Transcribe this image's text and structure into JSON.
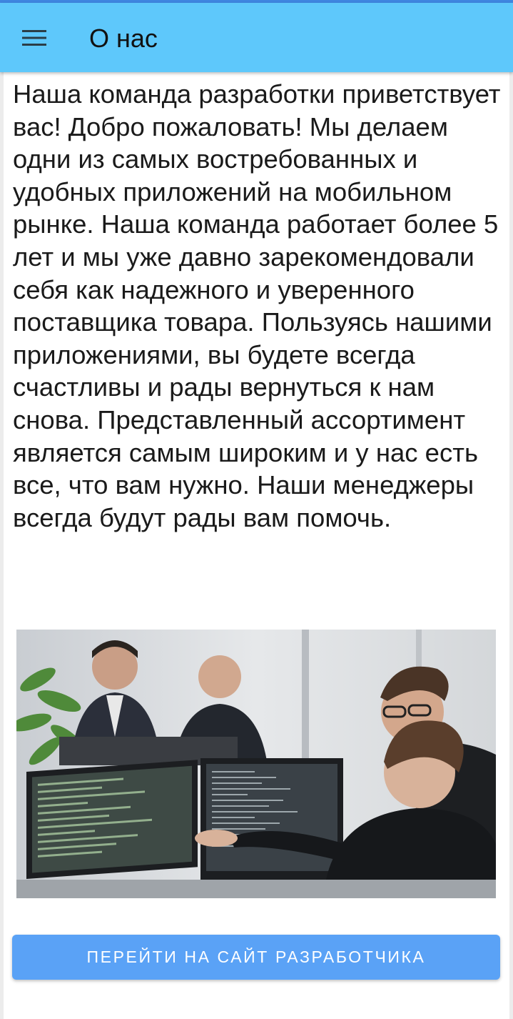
{
  "app_bar": {
    "title": "О нас",
    "menu_icon": "hamburger-menu-icon",
    "background": "#5ec8fb"
  },
  "about": {
    "text": "Наша команда разработки приветствует вас! Добро пожаловать! Мы делаем одни из самых востребованных и удобных приложений на мобильном рынке. Наша команда работает более 5 лет и мы уже давно зарекомендовали себя как надежного и уверенного поставщика товара. Пользуясь нашими приложениями, вы будете всегда счастливы и рады вернуться к нам снова. Представленный ассортимент является самым широким и у нас есть все, что вам нужно. Наши менеджеры всегда будут рады вам помочь."
  },
  "photo": {
    "icon": "team-at-monitors-photo"
  },
  "cta": {
    "label": "ПЕРЕЙТИ НА САЙТ РАЗРАБОТЧИКА",
    "color": "#5aa2f6"
  }
}
